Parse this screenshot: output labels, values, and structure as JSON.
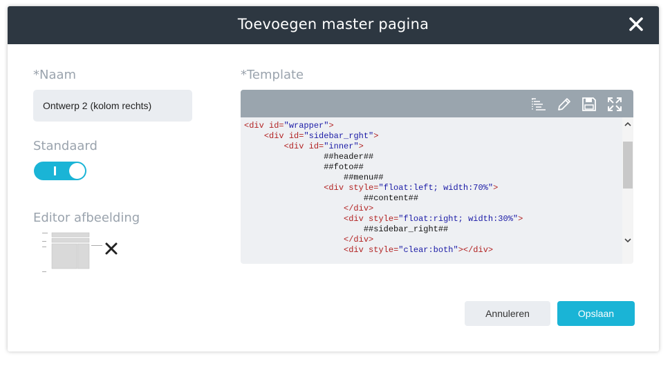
{
  "dialog": {
    "title": "Toevoegen master pagina"
  },
  "form": {
    "name_label": "*Naam",
    "name_value": "Ontwerp 2 (kolom rechts)",
    "default_label": "Standaard",
    "default_on": true,
    "toggle_text": "I",
    "editor_image_label": "Editor afbeelding",
    "template_label": "*Template"
  },
  "code_lines": [
    [
      {
        "t": "tag",
        "s": "<div "
      },
      {
        "t": "attr",
        "s": "id"
      },
      {
        "t": "tag",
        "s": "="
      },
      {
        "t": "val",
        "s": "\"wrapper\""
      },
      {
        "t": "tag",
        "s": ">"
      }
    ],
    [
      {
        "t": "plain",
        "s": "    "
      },
      {
        "t": "tag",
        "s": "<div "
      },
      {
        "t": "attr",
        "s": "id"
      },
      {
        "t": "tag",
        "s": "="
      },
      {
        "t": "val",
        "s": "\"sidebar_rght\""
      },
      {
        "t": "tag",
        "s": ">"
      }
    ],
    [
      {
        "t": "plain",
        "s": "        "
      },
      {
        "t": "tag",
        "s": "<div "
      },
      {
        "t": "attr",
        "s": "id"
      },
      {
        "t": "tag",
        "s": "="
      },
      {
        "t": "val",
        "s": "\"inner\""
      },
      {
        "t": "tag",
        "s": ">"
      }
    ],
    [
      {
        "t": "plain",
        "s": "                ##header##"
      }
    ],
    [
      {
        "t": "plain",
        "s": "                ##foto##"
      }
    ],
    [
      {
        "t": "plain",
        "s": "                    ##menu##"
      }
    ],
    [
      {
        "t": "plain",
        "s": "                "
      },
      {
        "t": "tag",
        "s": "<div "
      },
      {
        "t": "attr",
        "s": "style"
      },
      {
        "t": "tag",
        "s": "="
      },
      {
        "t": "val",
        "s": "\"float:left; width:70%\""
      },
      {
        "t": "tag",
        "s": ">"
      }
    ],
    [
      {
        "t": "plain",
        "s": "                        ##content##"
      }
    ],
    [
      {
        "t": "plain",
        "s": "                    "
      },
      {
        "t": "tag",
        "s": "</div>"
      }
    ],
    [
      {
        "t": "plain",
        "s": "                    "
      },
      {
        "t": "tag",
        "s": "<div "
      },
      {
        "t": "attr",
        "s": "style"
      },
      {
        "t": "tag",
        "s": "="
      },
      {
        "t": "val",
        "s": "\"float:right; width:30%\""
      },
      {
        "t": "tag",
        "s": ">"
      }
    ],
    [
      {
        "t": "plain",
        "s": "                        ##sidebar_right##"
      }
    ],
    [
      {
        "t": "plain",
        "s": "                    "
      },
      {
        "t": "tag",
        "s": "</div>"
      }
    ],
    [
      {
        "t": "plain",
        "s": "                    "
      },
      {
        "t": "tag",
        "s": "<div "
      },
      {
        "t": "attr",
        "s": "style"
      },
      {
        "t": "tag",
        "s": "="
      },
      {
        "t": "val",
        "s": "\"clear:both\""
      },
      {
        "t": "tag",
        "s": "></div>"
      }
    ]
  ],
  "toolbar_icons": [
    "format-icon",
    "pencil-icon",
    "save-icon",
    "fullscreen-icon"
  ],
  "buttons": {
    "cancel": "Annuleren",
    "save": "Opslaan"
  },
  "colors": {
    "header_bg": "#2d3741",
    "accent": "#1ab4d6",
    "toolbar_bg": "#9aa5ae",
    "code_tag": "#b22222",
    "code_value": "#1a1aa6"
  }
}
